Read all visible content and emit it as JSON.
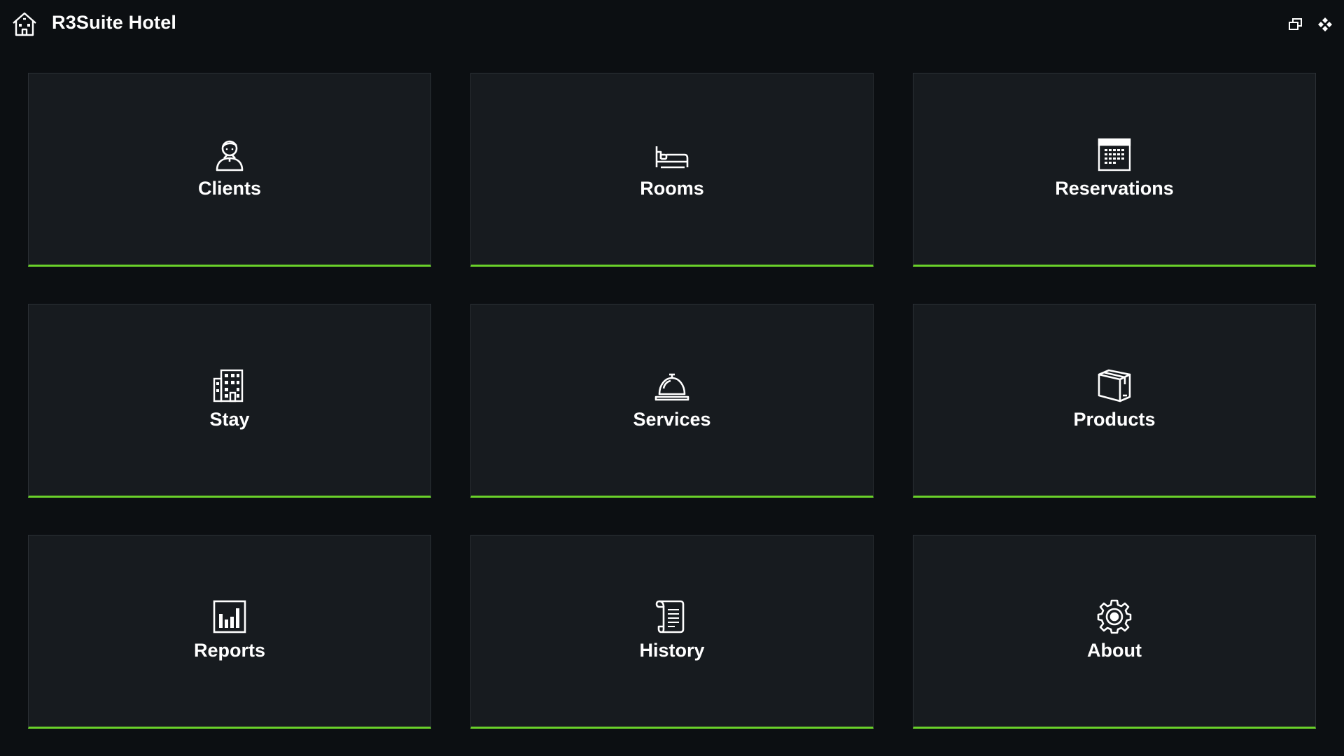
{
  "app": {
    "title": "R3Suite Hotel",
    "icon": "hotel-home-icon"
  },
  "window_controls": [
    {
      "name": "restore-icon"
    },
    {
      "name": "pin-icon"
    }
  ],
  "colors": {
    "background": "#0c0f12",
    "tile": "#171b1f",
    "accent": "#6ad12a"
  },
  "tiles": [
    {
      "label": "Clients",
      "icon": "client-person-icon"
    },
    {
      "label": "Rooms",
      "icon": "bed-icon"
    },
    {
      "label": "Reservations",
      "icon": "calendar-icon"
    },
    {
      "label": "Stay",
      "icon": "hotel-building-icon"
    },
    {
      "label": "Services",
      "icon": "service-bell-icon"
    },
    {
      "label": "Products",
      "icon": "box-icon"
    },
    {
      "label": "Reports",
      "icon": "bar-chart-icon"
    },
    {
      "label": "History",
      "icon": "scroll-icon"
    },
    {
      "label": "About",
      "icon": "gear-icon"
    }
  ]
}
